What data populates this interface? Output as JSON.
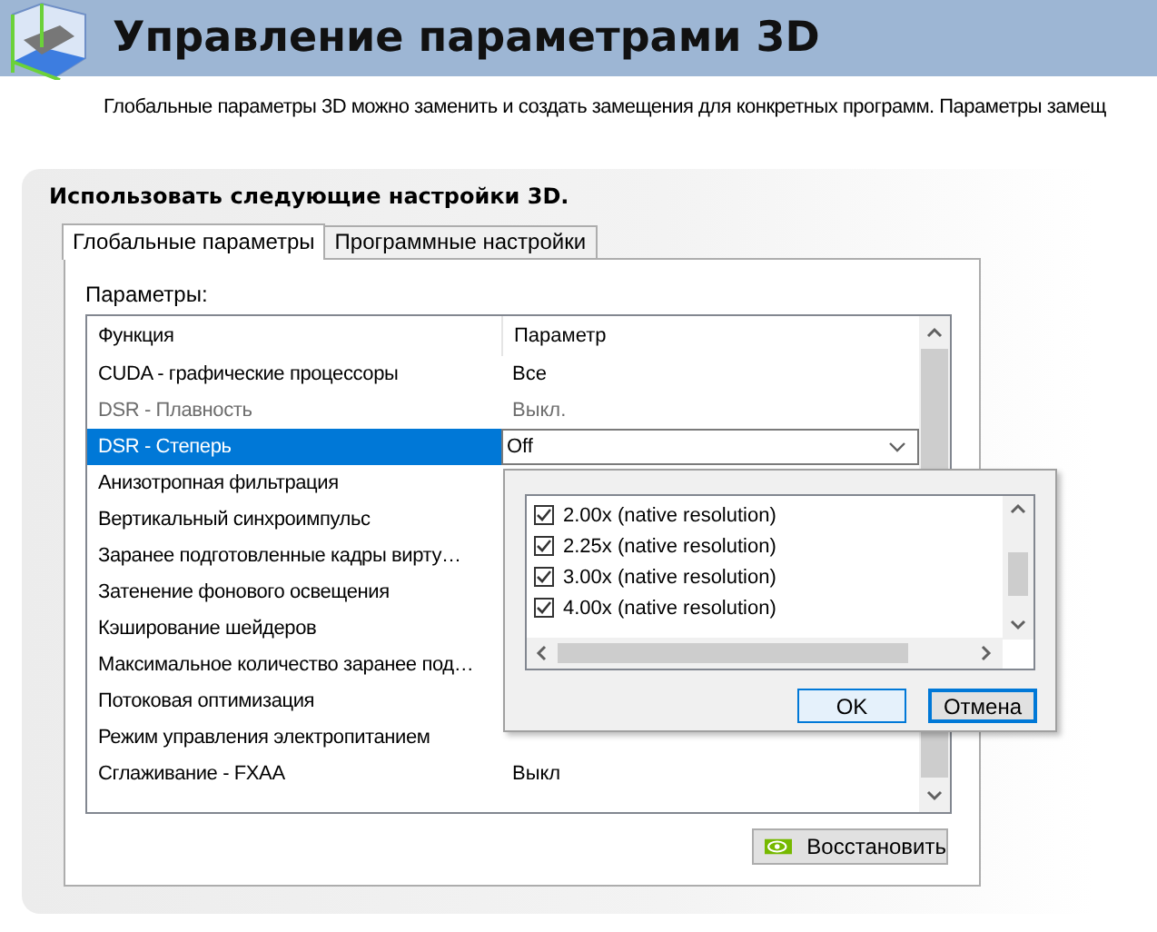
{
  "header": {
    "title": "Управление параметрами 3D",
    "description": "Глобальные параметры 3D можно заменить и создать замещения для конкретных программ. Параметры замещ"
  },
  "panel": {
    "heading": "Использовать следующие настройки 3D.",
    "tabs": [
      {
        "label": "Глобальные параметры",
        "selected": true
      },
      {
        "label": "Программные настройки",
        "selected": false
      }
    ],
    "params_label": "Параметры:",
    "columns": [
      "Функция",
      "Параметр"
    ],
    "rows": [
      {
        "function": "CUDA - графические процессоры",
        "value": "Все",
        "disabled": false,
        "selected": false
      },
      {
        "function": "DSR - Плавность",
        "value": "Выкл.",
        "disabled": true,
        "selected": false
      },
      {
        "function": "DSR - Степерь",
        "value": "Off",
        "disabled": false,
        "selected": true
      },
      {
        "function": "Анизотропная фильтрация",
        "disabled": false,
        "selected": false
      },
      {
        "function": "Вертикальный синхроимпульс",
        "disabled": false,
        "selected": false
      },
      {
        "function": "Заранее подготовленные кадры вирту…",
        "disabled": false,
        "selected": false
      },
      {
        "function": "Затенение фонового освещения",
        "disabled": false,
        "selected": false
      },
      {
        "function": "Кэширование шейдеров",
        "disabled": false,
        "selected": false
      },
      {
        "function": "Максимальное количество заранее под…",
        "disabled": false,
        "selected": false
      },
      {
        "function": "Потоковая оптимизация",
        "disabled": false,
        "selected": false
      },
      {
        "function": "Режим управления электропитанием",
        "disabled": false,
        "selected": false
      },
      {
        "function": "Сглаживание - FXAA",
        "value": "Выкл",
        "disabled": false,
        "selected": false
      }
    ],
    "restore_button": "Восстановить"
  },
  "popup": {
    "options": [
      {
        "label": "2.00x (native resolution)",
        "checked": true
      },
      {
        "label": "2.25x (native resolution)",
        "checked": true
      },
      {
        "label": "3.00x (native resolution)",
        "checked": true
      },
      {
        "label": "4.00x (native resolution)",
        "checked": true
      }
    ],
    "buttons": [
      {
        "label": "OK",
        "kind": "default"
      },
      {
        "label": "Отмена",
        "kind": "focused"
      }
    ]
  }
}
